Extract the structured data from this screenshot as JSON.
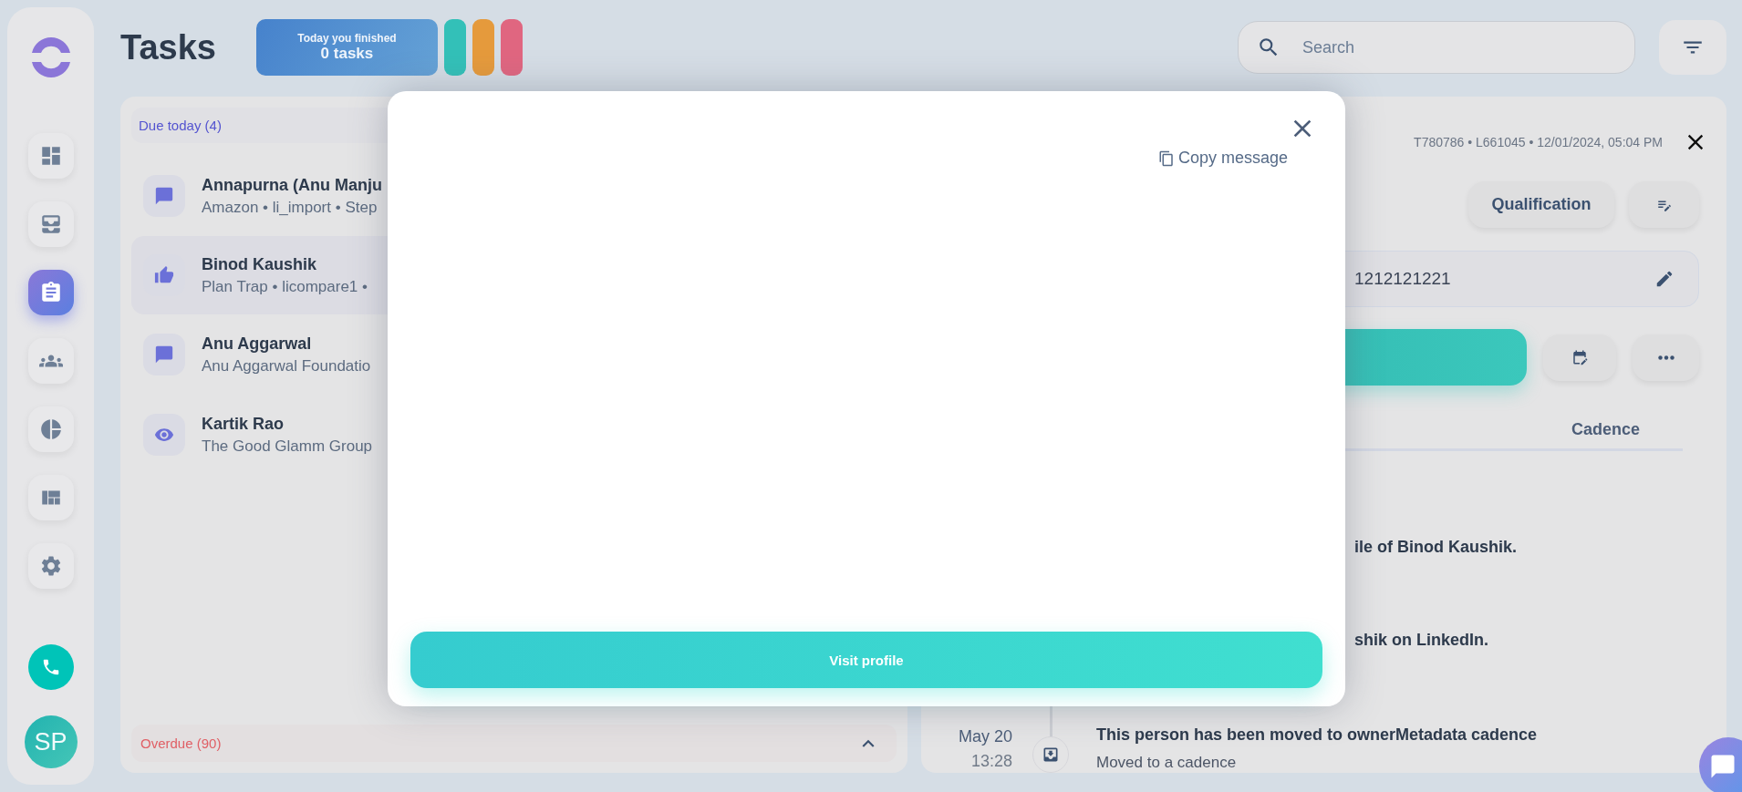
{
  "sidebar": {
    "nav": [
      {
        "selected": false
      },
      {
        "selected": false
      },
      {
        "selected": true
      },
      {
        "selected": false
      },
      {
        "selected": false
      },
      {
        "selected": false
      },
      {
        "selected": false
      }
    ],
    "avatar": "SP"
  },
  "header": {
    "title": "Tasks",
    "stats": {
      "caption": "Today you finished",
      "value": "0 tasks"
    },
    "pills": [
      {
        "color": "#33c0b8"
      },
      {
        "color": "#e59a3c"
      },
      {
        "color": "#e06680"
      }
    ],
    "search": {
      "placeholder": "Search"
    }
  },
  "task_list": {
    "section": "Due today (4)",
    "tasks": [
      {
        "name": "Annapurna (Anu Manju",
        "detail": "Amazon • li_import • Step",
        "kind": "message",
        "selected": false
      },
      {
        "name": "Binod Kaushik",
        "detail": "Plan Trap • licompare1 •",
        "kind": "like",
        "selected": true
      },
      {
        "name": "Anu Aggarwal",
        "detail": "Anu Aggarwal Foundatio",
        "kind": "message",
        "selected": false
      },
      {
        "name": "Kartik Rao",
        "detail": "The Good Glamm Group",
        "kind": "view",
        "selected": false
      }
    ],
    "overdue": {
      "label": "Overdue (90)",
      "expanded": false
    }
  },
  "detail": {
    "meta": "T780786 • L661045 • 12/01/2024, 05:04 PM",
    "qualification": "Qualification",
    "phone": "1212121221",
    "tabs": [
      {
        "label": "Cadence",
        "selected": false
      }
    ],
    "timeline": [
      {
        "title": "ile of Binod Kaushik."
      },
      {
        "title": "shik on LinkedIn."
      },
      {
        "date": "May 20",
        "time": "13:28",
        "title": "This person has been moved to ownerMetadata cadence",
        "subtitle": "Moved to a cadence"
      }
    ]
  },
  "modal": {
    "copy": "Copy message",
    "action": "Visit profile"
  }
}
